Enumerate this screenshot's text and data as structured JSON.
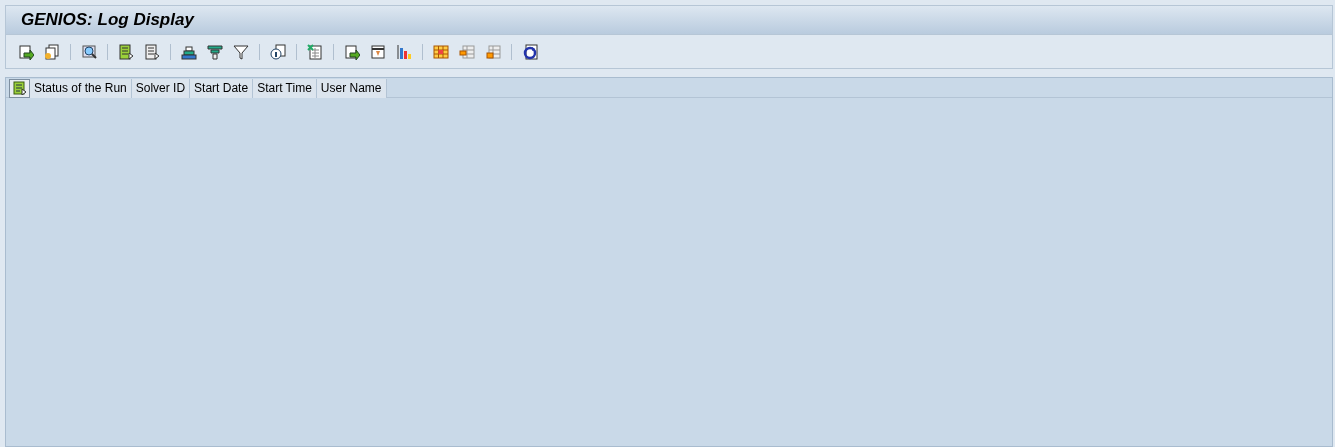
{
  "window": {
    "title": "GENIOS: Log Display"
  },
  "table": {
    "columns": [
      "Status of the Run",
      "Solver ID",
      "Start Date",
      "Start Time",
      "User Name"
    ]
  }
}
